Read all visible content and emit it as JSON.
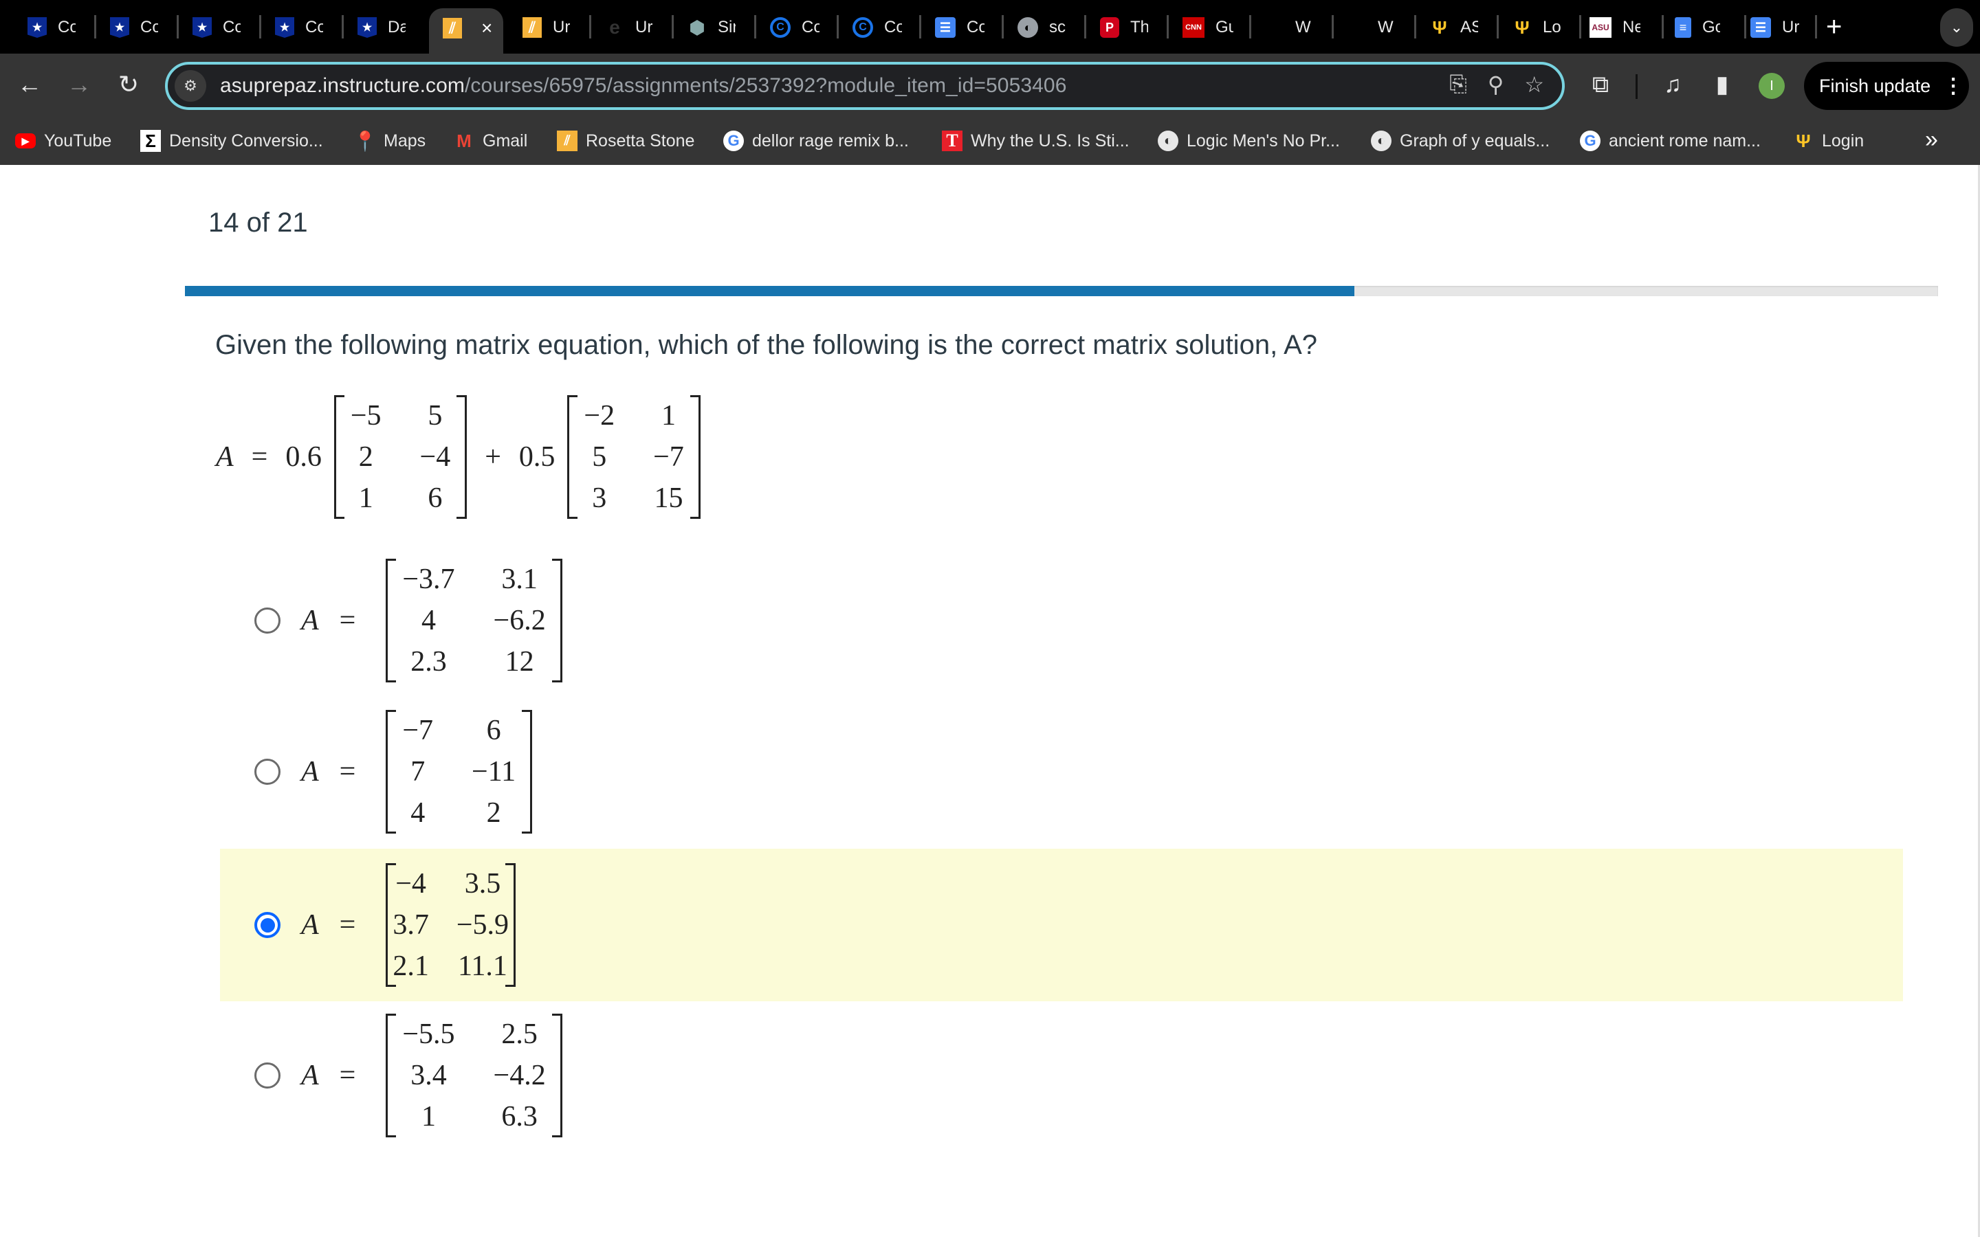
{
  "browser": {
    "tabs": [
      {
        "icon": "shield-star-icon",
        "title": "Co"
      },
      {
        "icon": "shield-star-icon",
        "title": "Co"
      },
      {
        "icon": "shield-star-icon",
        "title": "Co"
      },
      {
        "icon": "shield-star-icon",
        "title": "Co"
      },
      {
        "icon": "shield-star-icon",
        "title": "Da"
      },
      {
        "icon": "rosetta-icon",
        "title": "",
        "active": true,
        "close": "×"
      },
      {
        "icon": "rosetta-icon",
        "title": "Ur"
      },
      {
        "icon": "rainbow-e-icon",
        "title": "Ur"
      },
      {
        "icon": "simulation-icon",
        "title": "Sir"
      },
      {
        "icon": "circle-c-icon",
        "title": "Co"
      },
      {
        "icon": "circle-c-icon",
        "title": "Co"
      },
      {
        "icon": "docs-icon",
        "title": "Co"
      },
      {
        "icon": "globe-icon",
        "title": "sc"
      },
      {
        "icon": "p-icon",
        "title": "Th"
      },
      {
        "icon": "cnn-icon",
        "title": "Gu"
      },
      {
        "icon": "blank-icon",
        "title": "W"
      },
      {
        "icon": "blank-icon",
        "title": "W"
      },
      {
        "icon": "trident-icon",
        "title": "AS"
      },
      {
        "icon": "trident-icon",
        "title": "Lo"
      },
      {
        "icon": "asu-icon",
        "title": "Ne"
      },
      {
        "icon": "google-doc-icon",
        "title": "Go"
      },
      {
        "icon": "docs-icon",
        "title": "Ur"
      }
    ],
    "new_tab": "+",
    "tab_search": "⌄",
    "url_host": "asuprepaz.instructure.com",
    "url_path": "/courses/65975/assignments/2537392?module_item_id=5053406",
    "finish_update": "Finish update",
    "menu_dots": "⋮",
    "profile_initial": "I",
    "bookmarks": [
      {
        "icon": "youtube-icon",
        "label": "YouTube"
      },
      {
        "icon": "sigma-icon",
        "label": "Density Conversio..."
      },
      {
        "icon": "maps-icon",
        "label": "Maps"
      },
      {
        "icon": "gmail-icon",
        "label": "Gmail"
      },
      {
        "icon": "rosetta-icon",
        "label": "Rosetta Stone"
      },
      {
        "icon": "google-icon",
        "label": "dellor rage remix b..."
      },
      {
        "icon": "t-icon",
        "label": "Why the U.S. Is Sti..."
      },
      {
        "icon": "globe-icon",
        "label": "Logic Men's No Pr..."
      },
      {
        "icon": "globe-icon",
        "label": "Graph of y equals..."
      },
      {
        "icon": "google-icon",
        "label": "ancient rome nam..."
      },
      {
        "icon": "trident-icon",
        "label": "Login"
      }
    ],
    "bookmarks_overflow": "»"
  },
  "quiz": {
    "counter": "14 of 21",
    "current": 14,
    "total": 21,
    "progress_fraction": 0.667,
    "accent_color": "#1674af",
    "question": "Given the following matrix equation, which of the following is the correct matrix solution, A?",
    "equation": {
      "lhs": "A",
      "equals": "=",
      "coef1": "0.6",
      "matrix1": [
        [
          "−5",
          "5"
        ],
        [
          "2",
          "−4"
        ],
        [
          "1",
          "6"
        ]
      ],
      "plus": "+",
      "coef2": "0.5",
      "matrix2": [
        [
          "−2",
          "1"
        ],
        [
          "5",
          "−7"
        ],
        [
          "3",
          "15"
        ]
      ]
    },
    "options": [
      {
        "lhs": "A",
        "equals": "=",
        "matrix": [
          [
            "−3.7",
            "3.1"
          ],
          [
            "4",
            "−6.2"
          ],
          [
            "2.3",
            "12"
          ]
        ],
        "selected": false
      },
      {
        "lhs": "A",
        "equals": "=",
        "matrix": [
          [
            "−7",
            "6"
          ],
          [
            "7",
            "−11"
          ],
          [
            "4",
            "2"
          ]
        ],
        "selected": false
      },
      {
        "lhs": "A",
        "equals": "=",
        "matrix": [
          [
            "−4",
            "3.5"
          ],
          [
            "3.7",
            "−5.9"
          ],
          [
            "2.1",
            "11.1"
          ]
        ],
        "selected": true
      },
      {
        "lhs": "A",
        "equals": "=",
        "matrix": [
          [
            "−5.5",
            "2.5"
          ],
          [
            "3.4",
            "−4.2"
          ],
          [
            "1",
            "6.3"
          ]
        ],
        "selected": false
      }
    ],
    "selected_highlight_color": "#fbfbd7",
    "radio_color": "#0b66ff"
  }
}
